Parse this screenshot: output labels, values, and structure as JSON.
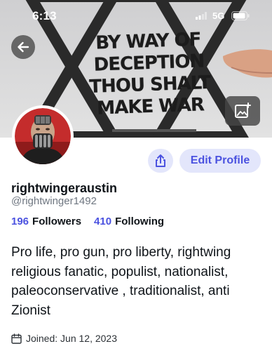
{
  "status_bar": {
    "time": "6:13",
    "network": "5G"
  },
  "banner": {
    "text_lines": [
      "BY WAY OF",
      "DECEPTION",
      "THOU SHALT",
      "MAKE WAR"
    ]
  },
  "profile": {
    "display_name": "rightwingeraustin",
    "handle": "@rightwinger1492",
    "followers_count": "196",
    "followers_label": "Followers",
    "following_count": "410",
    "following_label": "Following",
    "bio": "Pro life, pro gun, pro liberty, rightwing religious fanatic, populist, nationalist, paleoconservative , traditionalist, anti Zionist",
    "joined": "Joined: Jun 12, 2023"
  },
  "actions": {
    "edit_profile_label": "Edit Profile"
  },
  "icons": {
    "back": "arrow-left-icon",
    "add_image": "image-plus-icon",
    "share": "share-icon",
    "calendar": "calendar-icon"
  },
  "colors": {
    "accent": "#4b52e0",
    "button_bg": "#e3e6fb",
    "muted_text": "#6e7680"
  }
}
